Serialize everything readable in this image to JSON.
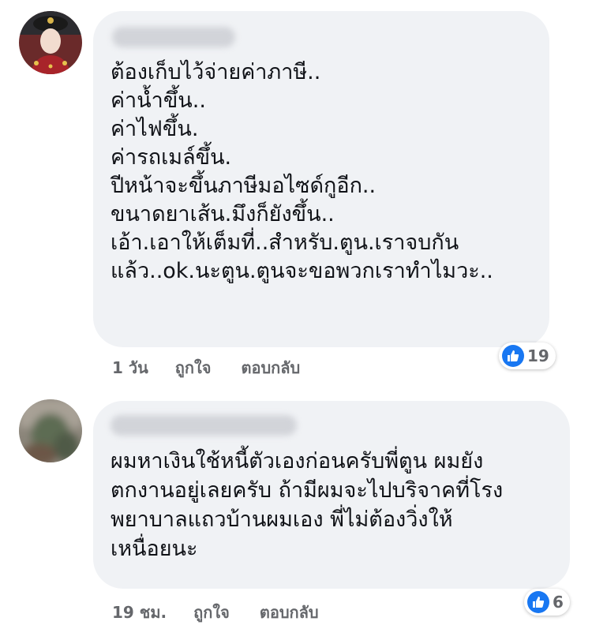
{
  "comments": [
    {
      "text_lines": [
        "ต้องเก็บไว้จ่ายค่าภาษี..",
        "ค่าน้ำขึ้น..",
        "ค่าไฟขึ้น.",
        "ค่ารถเมล์ขึ้น.",
        "ปีหน้าจะขึ้นภาษีมอไซด์กูอีก..",
        "ขนาดยาเส้น.มึงก็ยังขึ้น..",
        "เอ้า.เอาให้เต็มที่..สำหรับ.ตูน.เราจบกัน",
        "แล้ว..ok.นะตูน.ตูนจะขอพวกเราทำไมวะ.."
      ],
      "time": "1 วัน",
      "like_label": "ถูกใจ",
      "reply_label": "ตอบกลับ",
      "reaction_count": "19"
    },
    {
      "text_lines": [
        "ผมหาเงินใช้หนี้ตัวเองก่อนครับพี่ตูน ผมยัง",
        "ตกงานอยู่เลยครับ ถ้ามีผมจะไปบริจาคที่โรง",
        "พยาบาลแถวบ้านผมเอง พี่ไม่ต้องวิ่งให้",
        "เหนื่อยนะ"
      ],
      "time": "19 ชม.",
      "like_label": "ถูกใจ",
      "reply_label": "ตอบกลับ",
      "reaction_count": "6"
    }
  ],
  "colors": {
    "bubble": "#f0f2f5",
    "text": "#101217",
    "meta": "#65676b",
    "like_blue": "#1877f2"
  },
  "icons": {
    "reaction": "thumbs-up-icon"
  }
}
